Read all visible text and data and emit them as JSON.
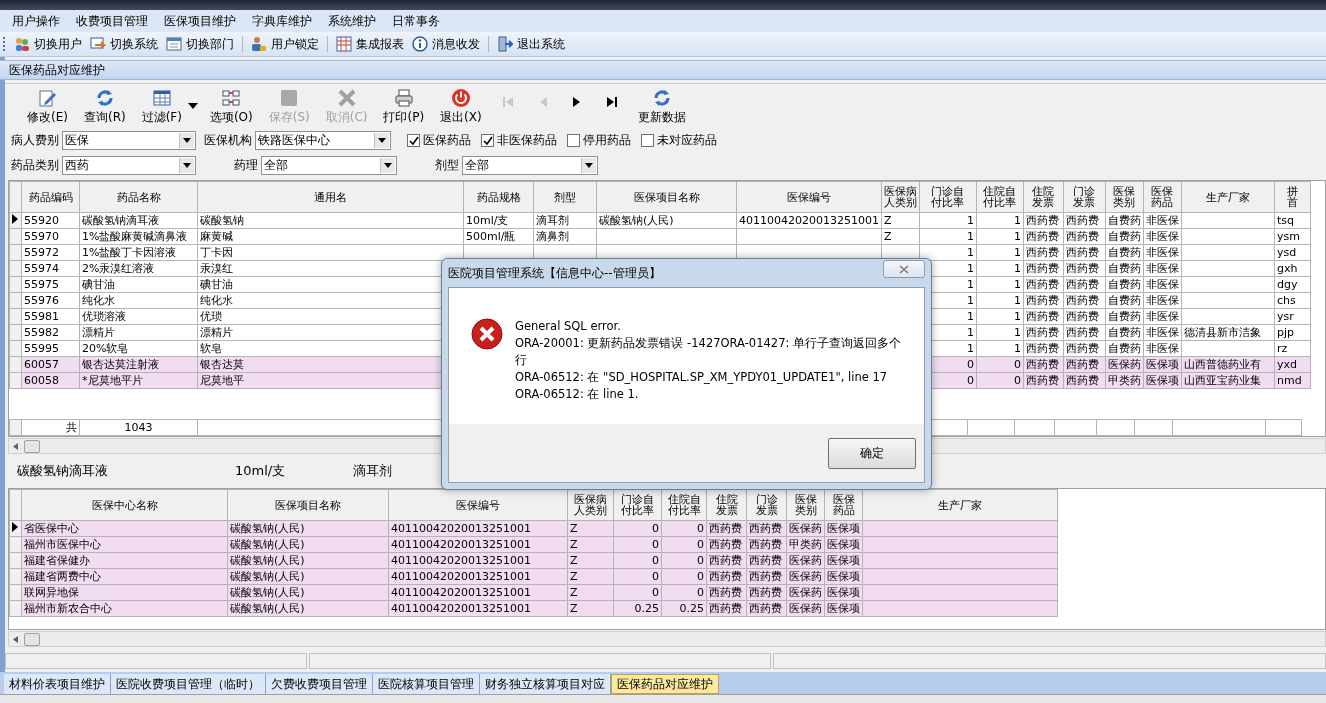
{
  "menu": [
    "用户操作",
    "收费项目管理",
    "医保项目维护",
    "字典库维护",
    "系统维护",
    "日常事务"
  ],
  "toolbar_groups": [
    [
      "切换用户",
      "切换系统",
      "切换部门"
    ],
    [
      "用户锁定"
    ],
    [
      "集成报表",
      "消息收发"
    ],
    [
      "退出系统"
    ]
  ],
  "panel": {
    "title": "医保药品对应维护"
  },
  "actions": [
    {
      "kind": "button",
      "label": "修改(E)",
      "disabled": false
    },
    {
      "kind": "button",
      "label": "查询(R)",
      "disabled": false
    },
    {
      "kind": "button",
      "label": "过滤(F)",
      "disabled": false
    },
    {
      "kind": "dropdown",
      "disabled": false
    },
    {
      "kind": "button",
      "label": "选项(O)",
      "disabled": false
    },
    {
      "kind": "button",
      "label": "保存(S)",
      "disabled": true
    },
    {
      "kind": "button",
      "label": "取消(C)",
      "disabled": true
    },
    {
      "kind": "button",
      "label": "打印(P)",
      "disabled": false
    },
    {
      "kind": "button",
      "label": "退出(X)",
      "disabled": false
    },
    {
      "kind": "nav",
      "disabled": true
    },
    {
      "kind": "nav",
      "disabled": true
    },
    {
      "kind": "nav",
      "disabled": false
    },
    {
      "kind": "nav",
      "disabled": false
    },
    {
      "kind": "button",
      "label": "更新数据",
      "disabled": false
    }
  ],
  "filters": [
    [
      {
        "kind": "select",
        "label": "病人费别",
        "value": "医保"
      },
      {
        "kind": "select",
        "label": "医保机构",
        "value": "铁路医保中心"
      },
      {
        "kind": "checkbox",
        "label": "医保药品",
        "checked": true
      },
      {
        "kind": "checkbox",
        "label": "非医保药品",
        "checked": true
      },
      {
        "kind": "checkbox",
        "label": "停用药品",
        "checked": false
      },
      {
        "kind": "checkbox",
        "label": "未对应药品",
        "checked": false
      }
    ],
    [
      {
        "kind": "select",
        "label": "药品类别",
        "value": "西药"
      },
      {
        "kind": "select",
        "label": "药理",
        "value": "全部"
      },
      {
        "kind": "select",
        "label": "剂型",
        "value": "全部"
      }
    ]
  ],
  "drug_table": {
    "columns": [
      "药品编码",
      "药品名称",
      "通用名",
      "药品规格",
      "剂型",
      "医保项目名称",
      "医保编号",
      "医保病人类别",
      "门诊自付比率",
      "住院自付比率",
      "住院发票",
      "门诊发票",
      "医保类别",
      "医保药品",
      "生产厂家",
      "拼首"
    ],
    "rows": [
      {
        "selected": true,
        "highlighted": false,
        "cells": [
          "55920",
          "碳酸氢钠滴耳液",
          "碳酸氢钠",
          "10ml/支",
          "滴耳剂",
          "碳酸氢钠(人民)",
          "40110042020013251001",
          "Z",
          "1",
          "1",
          "西药费",
          "西药费",
          "自费药",
          "非医保",
          null,
          "tsq"
        ]
      },
      {
        "selected": false,
        "highlighted": false,
        "cells": [
          "55970",
          "1%盐酸麻黄碱滴鼻液",
          "麻黄碱",
          "500ml/瓶",
          "滴鼻剂",
          null,
          null,
          "Z",
          "1",
          "1",
          "西药费",
          "西药费",
          "自费药",
          "非医保",
          null,
          "ysm"
        ]
      },
      {
        "selected": false,
        "highlighted": false,
        "cells": [
          "55972",
          "1%盐酸丁卡因溶液",
          "丁卡因",
          null,
          null,
          null,
          null,
          null,
          "1",
          "1",
          "西药费",
          "西药费",
          "自费药",
          "非医保",
          null,
          "ysd"
        ]
      },
      {
        "selected": false,
        "highlighted": false,
        "cells": [
          "55974",
          "2%汞溴红溶液",
          "汞溴红",
          null,
          null,
          null,
          null,
          null,
          "1",
          "1",
          "西药费",
          "西药费",
          "自费药",
          "非医保",
          null,
          "gxh"
        ]
      },
      {
        "selected": false,
        "highlighted": false,
        "cells": [
          "55975",
          "碘甘油",
          "碘甘油",
          null,
          null,
          null,
          null,
          null,
          "1",
          "1",
          "西药费",
          "西药费",
          "自费药",
          "非医保",
          null,
          "dgy"
        ]
      },
      {
        "selected": false,
        "highlighted": false,
        "cells": [
          "55976",
          "纯化水",
          "纯化水",
          null,
          null,
          null,
          null,
          null,
          "1",
          "1",
          "西药费",
          "西药费",
          "自费药",
          "非医保",
          null,
          "chs"
        ]
      },
      {
        "selected": false,
        "highlighted": false,
        "cells": [
          "55981",
          "优琐溶液",
          "优琐",
          null,
          null,
          null,
          null,
          null,
          "1",
          "1",
          "西药费",
          "西药费",
          "自费药",
          "非医保",
          null,
          "ysr"
        ]
      },
      {
        "selected": false,
        "highlighted": false,
        "cells": [
          "55982",
          "漂精片",
          "漂精片",
          null,
          null,
          null,
          null,
          null,
          "1",
          "1",
          "西药费",
          "西药费",
          "自费药",
          "非医保",
          "德清县新市洁象",
          "pjp"
        ]
      },
      {
        "selected": false,
        "highlighted": false,
        "cells": [
          "55995",
          "20%软皂",
          "软皂",
          null,
          null,
          null,
          null,
          null,
          "1",
          "1",
          "西药费",
          "西药费",
          "自费药",
          "非医保",
          null,
          "rz"
        ]
      },
      {
        "selected": false,
        "highlighted": true,
        "cells": [
          "60057",
          "银杏达莫注射液",
          "银杏达莫",
          null,
          null,
          null,
          null,
          null,
          "0",
          "0",
          "西药费",
          "西药费",
          "医保药",
          "医保项",
          "山西普德药业有",
          "yxd"
        ]
      },
      {
        "selected": false,
        "highlighted": true,
        "cells": [
          "60058",
          "*尼莫地平片",
          "尼莫地平",
          null,
          null,
          null,
          null,
          null,
          "0",
          "0",
          "西药费",
          "西药费",
          "甲类药",
          "医保项",
          "山西亚宝药业集",
          "nmd"
        ]
      }
    ],
    "summary": {
      "label": "共",
      "count": "1043"
    }
  },
  "selected_drug": {
    "name": "碳酸氢钠滴耳液",
    "spec": "10ml/支",
    "form": "滴耳剂"
  },
  "center_table": {
    "columns": [
      "医保中心名称",
      "医保项目名称",
      "医保编号",
      "医保病人类别",
      "门诊自付比率",
      "住院自付比率",
      "住院发票",
      "门诊发票",
      "医保类别",
      "医保药品",
      "生产厂家"
    ],
    "rows": [
      {
        "selected": true,
        "highlighted": true,
        "cells": [
          "省医保中心",
          "碳酸氢钠(人民)",
          "40110042020013251001",
          "Z",
          "0",
          "0",
          "西药费",
          "西药费",
          "医保药",
          "医保项",
          null
        ]
      },
      {
        "selected": false,
        "highlighted": true,
        "cells": [
          "福州市医保中心",
          "碳酸氢钠(人民)",
          "40110042020013251001",
          "Z",
          "0",
          "0",
          "西药费",
          "西药费",
          "甲类药",
          "医保项",
          null
        ]
      },
      {
        "selected": false,
        "highlighted": true,
        "cells": [
          "福建省保健办",
          "碳酸氢钠(人民)",
          "40110042020013251001",
          "Z",
          "0",
          "0",
          "西药费",
          "西药费",
          "医保药",
          "医保项",
          null
        ]
      },
      {
        "selected": false,
        "highlighted": true,
        "cells": [
          "福建省两费中心",
          "碳酸氢钠(人民)",
          "40110042020013251001",
          "Z",
          "0",
          "0",
          "西药费",
          "西药费",
          "医保药",
          "医保项",
          null
        ]
      },
      {
        "selected": false,
        "highlighted": true,
        "cells": [
          "联网异地保",
          "碳酸氢钠(人民)",
          "40110042020013251001",
          "Z",
          "0",
          "0",
          "西药费",
          "西药费",
          "医保药",
          "医保项",
          null
        ]
      },
      {
        "selected": false,
        "highlighted": true,
        "cells": [
          "福州市新农合中心",
          "碳酸氢钠(人民)",
          "40110042020013251001",
          "Z",
          "0.25",
          "0.25",
          "西药费",
          "西药费",
          "医保药",
          "医保项",
          null
        ]
      }
    ]
  },
  "tabs": [
    {
      "label": "材料价表项目维护",
      "selected": false
    },
    {
      "label": "医院收费项目管理（临时）",
      "selected": false
    },
    {
      "label": "欠费收费项目管理",
      "selected": false
    },
    {
      "label": "医院核算项目管理",
      "selected": false
    },
    {
      "label": "财务独立核算项目对应",
      "selected": false
    },
    {
      "label": "医保药品对应维护",
      "selected": true
    }
  ],
  "dialog": {
    "title": "医院项目管理系统【信息中心--管理员】",
    "message": [
      "General SQL error.",
      "ORA-20001: 更新药品发票错误 -1427ORA-01427: 单行子查询返回多个行",
      "ORA-06512: 在 \"SD_HOSPITAL.SP_XM_YPDY01_UPDATE1\", line 17",
      "ORA-06512: 在 line 1."
    ],
    "button": "确定"
  }
}
